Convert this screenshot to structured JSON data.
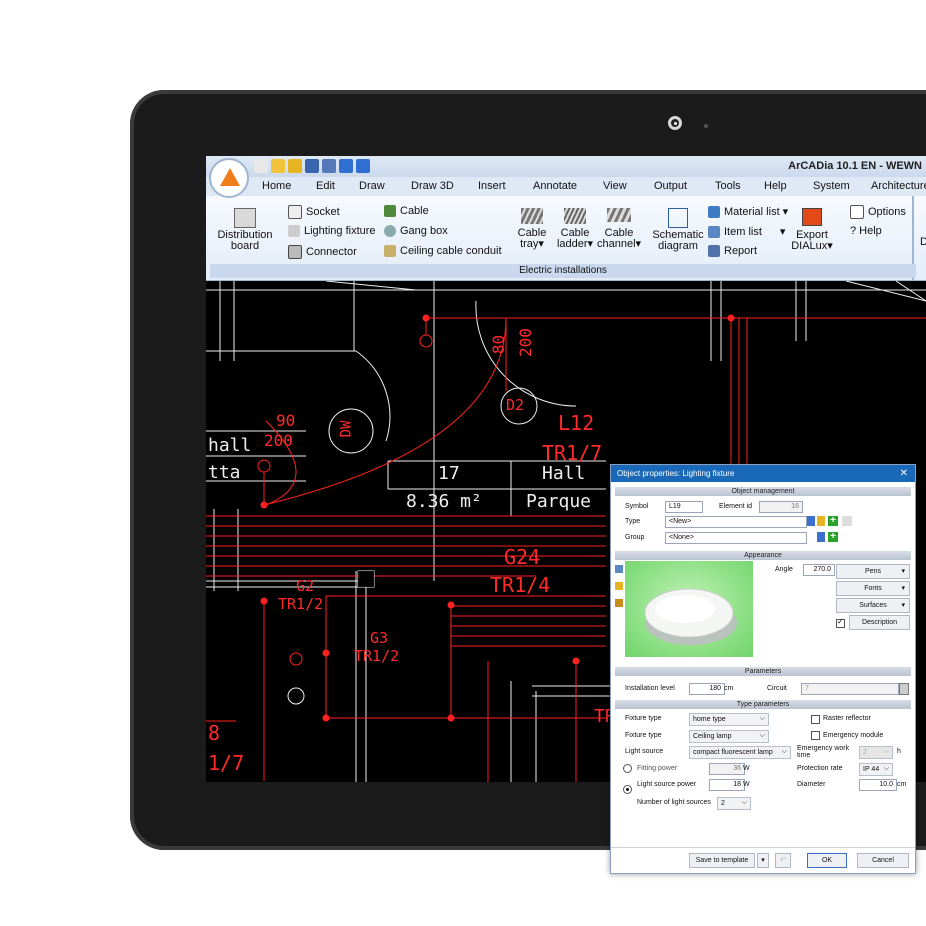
{
  "app": {
    "title": "ArCADia 10.1 EN - WEWN"
  },
  "menu": [
    "Home",
    "Edit",
    "Draw",
    "Draw 3D",
    "Insert",
    "Annotate",
    "View",
    "Output",
    "Tools",
    "Help",
    "System",
    "Architecture"
  ],
  "ribbon": {
    "distribution_board": "Distribution board",
    "socket": "Socket",
    "lighting_fixture": "Lighting fixture",
    "connector": "Connector",
    "cable": "Cable",
    "gang_box": "Gang box",
    "ceiling_cable_conduit": "Ceiling cable conduit",
    "cable_tray": "Cable tray▾",
    "cable_ladder": "Cable ladder▾",
    "cable_channel": "Cable channel▾",
    "schematic_diagram": "Schematic diagram",
    "material_list": "Material list ▾",
    "item_list": "Item list",
    "report": "Report",
    "export_dialux": "Export DIALux▾",
    "options": "Options",
    "help": "? Help",
    "group_label": "Electric installations",
    "cut_label": "D"
  },
  "drawing": {
    "labels": [
      "hall",
      "tta",
      "90",
      "200",
      "80",
      "200",
      "D2",
      "DW",
      "L12",
      "TR1/7",
      "17",
      "Hall",
      "8.36 m²",
      "Parque",
      "G24",
      "TR1/4",
      "G2",
      "TR1/2",
      "G3",
      "TR1/2",
      "TR",
      "8",
      "1/7"
    ]
  },
  "dialog": {
    "title": "Object properties: Lighting fixture",
    "close": "✕",
    "sections": {
      "management": "Object management",
      "appearance": "Appearance",
      "parameters": "Parameters",
      "type_parameters": "Type parameters"
    },
    "symbol_label": "Symbol",
    "symbol_value": "L19",
    "element_id_label": "Element id",
    "element_id_value": "16",
    "type_label": "Type",
    "type_value": "<New>",
    "group_label": "Group",
    "group_value": "<None>",
    "angle_label": "Angle",
    "angle_value": "270.0",
    "pens": "Pens",
    "fonts": "Fonts",
    "surfaces": "Surfaces",
    "description": "Description",
    "installation_level_label": "Installation level",
    "installation_level_value": "180",
    "cm": "cm",
    "circuit_label": "Circuit",
    "circuit_value": "7",
    "fixture_type1_label": "Fixture type",
    "fixture_type1_value": "home type",
    "fixture_type2_label": "Fixture type",
    "fixture_type2_value": "Ceiling lamp",
    "light_source_label": "Light source",
    "light_source_value": "compact fluorescent lamp",
    "fitting_power_label": "Fitting power",
    "fitting_power_value": "36",
    "w": "W",
    "light_source_power_label": "Light source power",
    "light_source_power_value": "18",
    "number_sources_label": "Number of light sources",
    "number_sources_value": "2",
    "raster_reflector": "Raster reflector",
    "emergency_module": "Emergency module",
    "emergency_work_label": "Emergency work time",
    "emergency_work_value": "2",
    "h": "h",
    "protection_label": "Protection rate",
    "protection_value": "IP 44",
    "diameter_label": "Diameter",
    "diameter_value": "10.0",
    "save_template": "Save to template",
    "ok": "OK",
    "cancel": "Cancel"
  }
}
